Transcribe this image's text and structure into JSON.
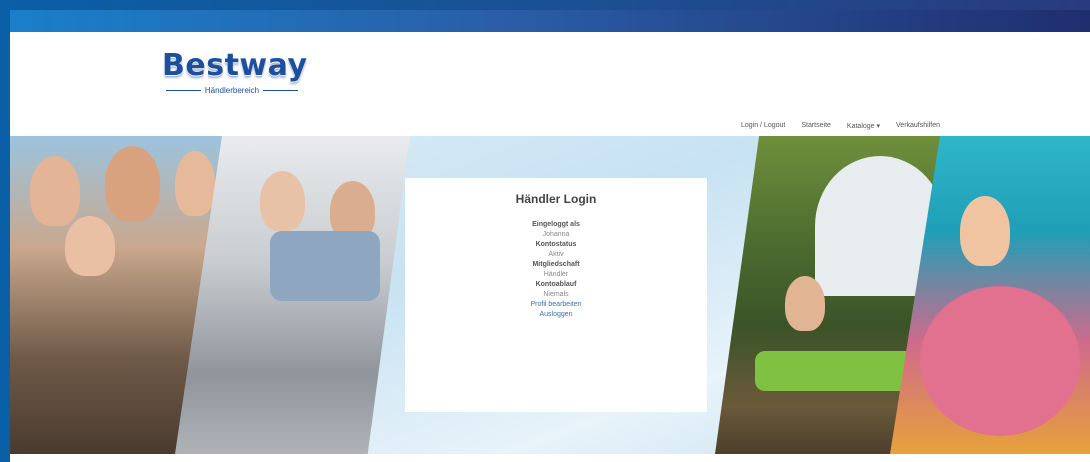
{
  "header": {
    "logo_word": "Bestway",
    "logo_sub": "Händlerbereich"
  },
  "nav": {
    "items": [
      {
        "label": "Login / Logout"
      },
      {
        "label": "Startseite"
      },
      {
        "label": "Kataloge ▾"
      },
      {
        "label": "Verkaufshilfen"
      }
    ]
  },
  "login": {
    "title": "Händler Login",
    "logged_in_label": "Eingeloggt als",
    "logged_in_value": "Johanna",
    "status_label": "Kontostatus",
    "status_value": "Aktiv",
    "membership_label": "Mitgliedschaft",
    "membership_value": "Händler",
    "expiry_label": "Kontoablauf",
    "expiry_value": "Niemals",
    "edit_profile": "Profil bearbeiten",
    "logout": "Ausloggen"
  },
  "colors": {
    "brand": "#1d4fa0",
    "link": "#3b6fb5"
  }
}
